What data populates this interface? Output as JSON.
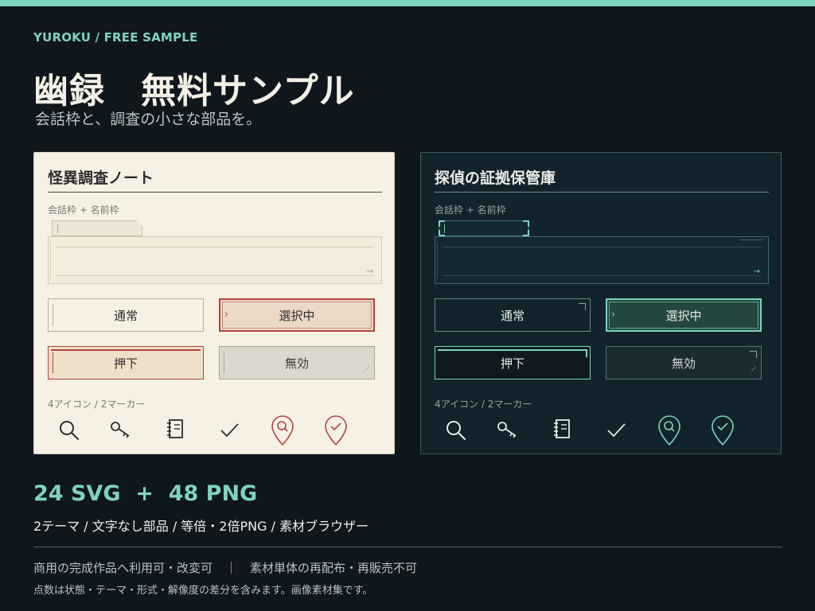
{
  "header": {
    "eyebrow": "YUROKU / FREE SAMPLE",
    "title": "幽録　無料サンプル",
    "subtitle": "会話枠と、調査の小さな部品を。"
  },
  "panels": {
    "light": {
      "title": "怪異調査ノート",
      "frame_label": "会話枠 + 名前枠",
      "buttons": {
        "normal": "通常",
        "selected": "選択中",
        "pressed": "押下",
        "disabled": "無効"
      },
      "icons_label": "4アイコン / 2マーカー",
      "accent": "#b2463e"
    },
    "dark": {
      "title": "探偵の証拠保管庫",
      "frame_label": "会話枠 + 名前枠",
      "buttons": {
        "normal": "通常",
        "selected": "選択中",
        "pressed": "押下",
        "disabled": "無効"
      },
      "icons_label": "4アイコン / 2マーカー",
      "accent": "#7ed3bf"
    }
  },
  "icons": [
    "search-icon",
    "key-icon",
    "notebook-icon",
    "check-icon",
    "search-marker-icon",
    "check-marker-icon"
  ],
  "summary": {
    "count": "24 SVG  +  48 PNG",
    "features": "2テーマ / 文字なし部品 / 等倍・2倍PNG / 素材ブラウザー",
    "license_commercial": "商用の完成作品へ利用可・改変可",
    "license_restriction": "素材単体の再配布・再販売不可",
    "note": "点数は状態・テーマ・形式・解像度の差分を含みます。画像素材集です。"
  },
  "colors": {
    "background": "#0f161c",
    "accent": "#7ed3bf",
    "light_panel": "#f6f1e4",
    "dark_panel": "#13232b"
  }
}
